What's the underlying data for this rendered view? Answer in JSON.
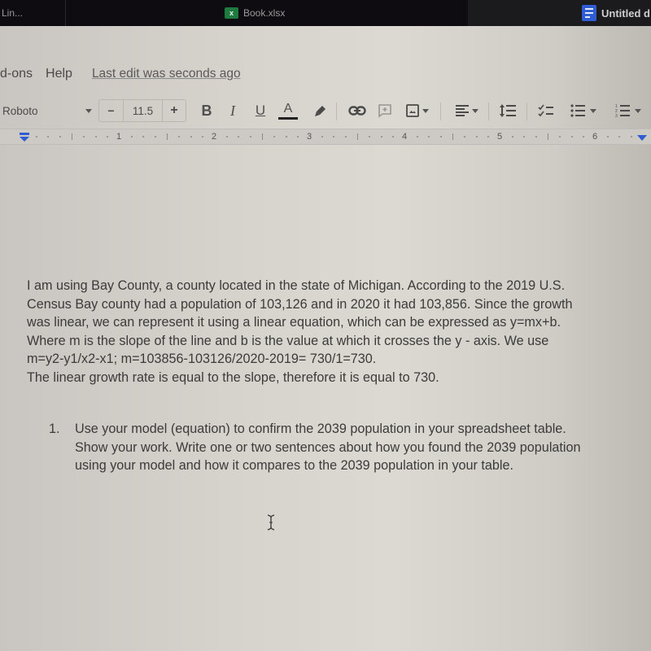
{
  "taskbar": {
    "items": [
      {
        "label": "Lin...",
        "icon": "none"
      },
      {
        "label": "Book.xlsx",
        "icon": "excel-icon",
        "icon_glyph": "x",
        "icon_color": "#1e7a3e"
      },
      {
        "label": "Untitled d",
        "icon": "google-docs-icon",
        "icon_color": "#2f5bd3",
        "active": true
      }
    ]
  },
  "menubar": {
    "items": [
      "d-ons",
      "Help"
    ],
    "last_edit": "Last edit was seconds ago"
  },
  "toolbar": {
    "font_family": "Roboto",
    "font_size": "11.5",
    "decrease_label": "−",
    "increase_label": "+",
    "bold_label": "B",
    "italic_label": "I",
    "underline_label": "U",
    "text_color_label": "A",
    "text_color": "#222222",
    "icons": [
      "highlight-pen-icon",
      "link-icon",
      "add-comment-icon",
      "insert-image-icon",
      "align-left-icon",
      "line-spacing-icon",
      "checklist-icon",
      "bulleted-list-icon",
      "numbered-list-icon"
    ]
  },
  "ruler": {
    "numbers": [
      "1",
      "2",
      "3",
      "4",
      "5",
      "6"
    ],
    "indent_color": "#2f5bd3"
  },
  "document": {
    "paragraph_lines": [
      "I am using Bay County, a county located in the state of Michigan. According to the 2019 U.S.",
      "Census Bay county had a population of 103,126 and in 2020 it had 103,856. Since the growth",
      "was linear, we can represent it using a linear equation, which can be expressed as y=mx+b.",
      "Where m is the slope of the line and b is the value at which it crosses the y - axis. We use",
      "m=y2-y1/x2-x1; m=103856-103126/2020-2019= 730/1=730.",
      "The linear growth rate is equal to the slope, therefore it is equal to 730."
    ],
    "list": [
      {
        "number": "1.",
        "lines": [
          "Use your model (equation) to confirm the 2039 population in your spreadsheet table.",
          "Show your work. Write one or two sentences about how you found the 2039 population",
          "using your model and how it compares to the 2039 population in your table."
        ]
      }
    ]
  }
}
